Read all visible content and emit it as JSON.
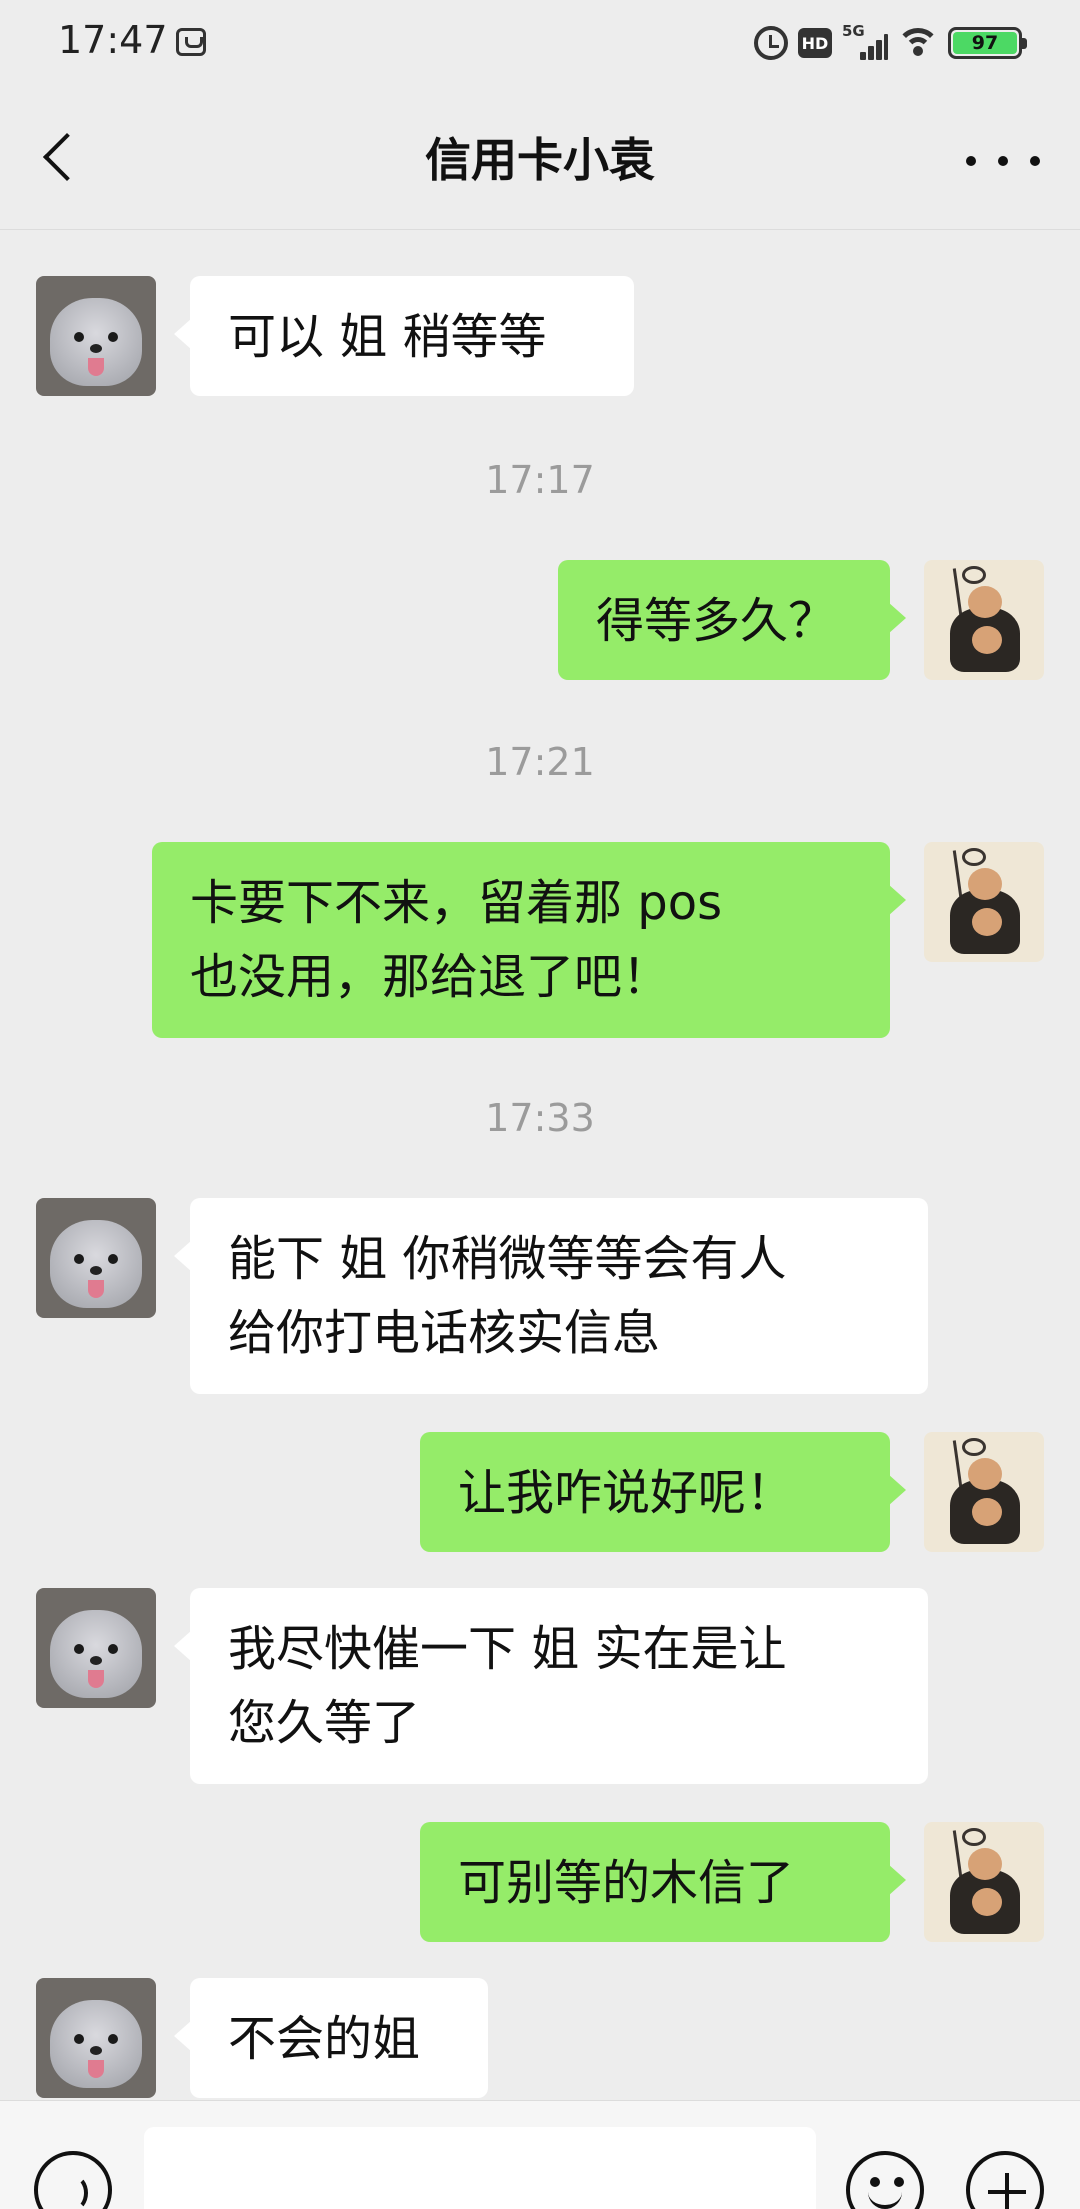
{
  "status_bar": {
    "time": "17:47",
    "hd_label": "HD",
    "network_label": "5G",
    "battery": "97"
  },
  "header": {
    "title": "信用卡小袁"
  },
  "messages": [
    {
      "side": "left",
      "text": "可以 姐 稍等等"
    },
    {
      "timestamp": "17:17"
    },
    {
      "side": "right",
      "text": "得等多久？"
    },
    {
      "timestamp": "17:21"
    },
    {
      "side": "right",
      "text": "卡要下不来，留着那 pos\n也没用，那给退了吧！"
    },
    {
      "timestamp": "17:33"
    },
    {
      "side": "left",
      "text": "能下 姐 你稍微等等会有人\n给你打电话核实信息"
    },
    {
      "side": "right",
      "text": "让我咋说好呢！"
    },
    {
      "side": "left",
      "text": "我尽快催一下 姐 实在是让\n您久等了"
    },
    {
      "side": "right",
      "text": "可别等的木信了"
    },
    {
      "side": "left",
      "text": "不会的姐"
    }
  ],
  "input_bar": {
    "placeholder": ""
  },
  "colors": {
    "background": "#ededed",
    "outgoing_bubble": "#95ec69",
    "incoming_bubble": "#ffffff",
    "battery_fill": "#4cd964"
  },
  "icons": {
    "back": "chevron-left-icon",
    "more": "ellipsis-icon",
    "voice": "voice-icon",
    "emoji": "emoji-icon",
    "plus": "plus-icon"
  }
}
